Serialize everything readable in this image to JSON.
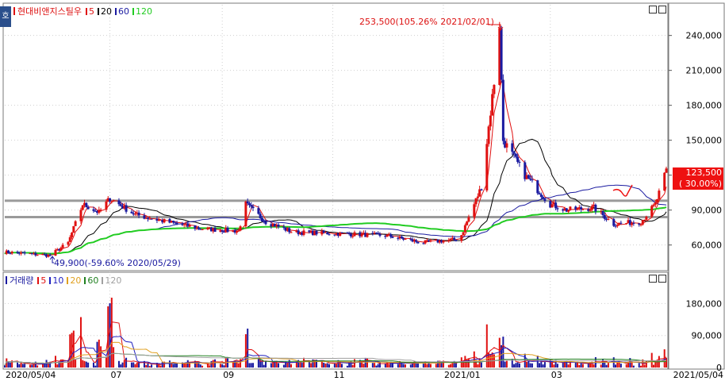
{
  "price_panel": {
    "stock_name": "현대비앤지스틸우",
    "ma_items": [
      {
        "label": "5",
        "color": "#e01010"
      },
      {
        "label": "20",
        "color": "#000000"
      },
      {
        "label": "60",
        "color": "#1a1aa0"
      },
      {
        "label": "120",
        "color": "#22cc22"
      }
    ],
    "high_annotation": "253,500(105.26% 2021/02/01)",
    "low_annotation": "49,900(-59.60% 2020/05/29)",
    "current_price": "123,500",
    "current_change": "( 30.00%)",
    "side_tab": "호"
  },
  "volume_panel": {
    "title": "거래량",
    "ma_items": [
      {
        "label": "5",
        "color": "#e01010"
      },
      {
        "label": "10",
        "color": "#2020c0"
      },
      {
        "label": "20",
        "color": "#e0a020"
      },
      {
        "label": "60",
        "color": "#208020"
      },
      {
        "label": "120",
        "color": "#a0a0a0"
      }
    ]
  },
  "x_axis": {
    "labels": [
      "2020/05/04",
      "07",
      "09",
      "11",
      "2021/01",
      "03",
      "2021/05/04"
    ]
  },
  "chart_data": [
    {
      "type": "candlestick",
      "x_start": "2020/05/04",
      "x_end": "2021/05/04",
      "ylim": [
        40000,
        265000
      ],
      "y_ticks": [
        60000,
        90000,
        120000,
        150000,
        180000,
        210000,
        240000
      ],
      "y_tick_labels": [
        "60,000",
        "90,000",
        "120,000",
        "150,000",
        "180,000",
        "210,000",
        "240,000"
      ],
      "horizontal_lines": [
        98000,
        84000
      ],
      "high": {
        "value": 253500,
        "date": "2021/02/01"
      },
      "low": {
        "value": 49900,
        "date": "2020/05/29"
      },
      "last_close": 123500,
      "approx_closes": [
        [
          "2020/05/04",
          54000
        ],
        [
          "2020/05/29",
          51000
        ],
        [
          "2020/06/08",
          62000
        ],
        [
          "2020/06/16",
          95000
        ],
        [
          "2020/06/25",
          88000
        ],
        [
          "2020/07/01",
          100000
        ],
        [
          "2020/07/15",
          86000
        ],
        [
          "2020/08/01",
          80000
        ],
        [
          "2020/08/20",
          74000
        ],
        [
          "2020/09/10",
          72000
        ],
        [
          "2020/09/14",
          95000
        ],
        [
          "2020/09/25",
          80000
        ],
        [
          "2020/10/10",
          71000
        ],
        [
          "2020/11/01",
          70000
        ],
        [
          "2020/12/01",
          68000
        ],
        [
          "2020/12/20",
          62000
        ],
        [
          "2021/01/10",
          65000
        ],
        [
          "2021/01/22",
          110000
        ],
        [
          "2021/01/29",
          200000
        ],
        [
          "2021/02/01",
          250000
        ],
        [
          "2021/02/03",
          150000
        ],
        [
          "2021/02/15",
          120000
        ],
        [
          "2021/03/01",
          95000
        ],
        [
          "2021/03/10",
          90000
        ],
        [
          "2021/03/25",
          92000
        ],
        [
          "2021/04/05",
          78000
        ],
        [
          "2021/04/20",
          80000
        ],
        [
          "2021/04/28",
          95000
        ],
        [
          "2021/05/04",
          123500
        ]
      ]
    },
    {
      "type": "bar",
      "name": "거래량",
      "ylim": [
        0,
        230000
      ],
      "y_ticks": [
        0,
        90000,
        180000
      ],
      "y_tick_labels": [
        "0",
        "90,000",
        "180,000"
      ],
      "approx_values": [
        [
          "2020/06/10",
          130000
        ],
        [
          "2020/06/14",
          190000
        ],
        [
          "2020/06/25",
          80000
        ],
        [
          "2020/07/01",
          220000
        ],
        [
          "2020/07/03",
          60000
        ],
        [
          "2020/09/14",
          130000
        ],
        [
          "2021/01/28",
          40000
        ],
        [
          "2021/02/01",
          60000
        ],
        [
          "2021/05/04",
          30000
        ]
      ]
    }
  ]
}
